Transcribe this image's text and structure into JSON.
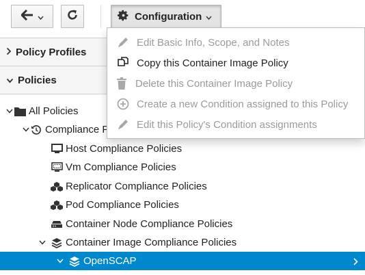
{
  "toolbar": {
    "back_icon": "arrow-left-icon",
    "refresh_icon": "refresh-icon",
    "configuration_label": "Configuration",
    "configuration_icon": "gear-icon"
  },
  "configuration_menu": {
    "items": [
      {
        "label": "Edit Basic Info, Scope, and Notes",
        "icon": "pencil-icon",
        "enabled": false
      },
      {
        "label": "Copy this Container Image Policy",
        "icon": "copy-icon",
        "enabled": true
      },
      {
        "label": "Delete this Container Image Policy",
        "icon": "trash-icon",
        "enabled": false
      },
      {
        "label": "Create a new Condition assigned to this Policy",
        "icon": "plus-circle-icon",
        "enabled": false
      },
      {
        "label": "Edit this Policy's Condition assignments",
        "icon": "pencil-icon",
        "enabled": false
      }
    ]
  },
  "accordion": {
    "policy_profiles": "Policy Profiles",
    "policies": "Policies"
  },
  "tree": {
    "all_policies": "All Policies",
    "compliance": "Compliance Policies",
    "host": "Host Compliance Policies",
    "vm": "Vm Compliance Policies",
    "replicator": "Replicator Compliance Policies",
    "pod": "Pod Compliance Policies",
    "container_node": "Container Node Compliance Policies",
    "container_image": "Container Image Compliance Policies",
    "openscap": "OpenSCAP"
  },
  "colors": {
    "selected_bg": "#0088ce",
    "disabled_text": "#9a9a9a"
  }
}
